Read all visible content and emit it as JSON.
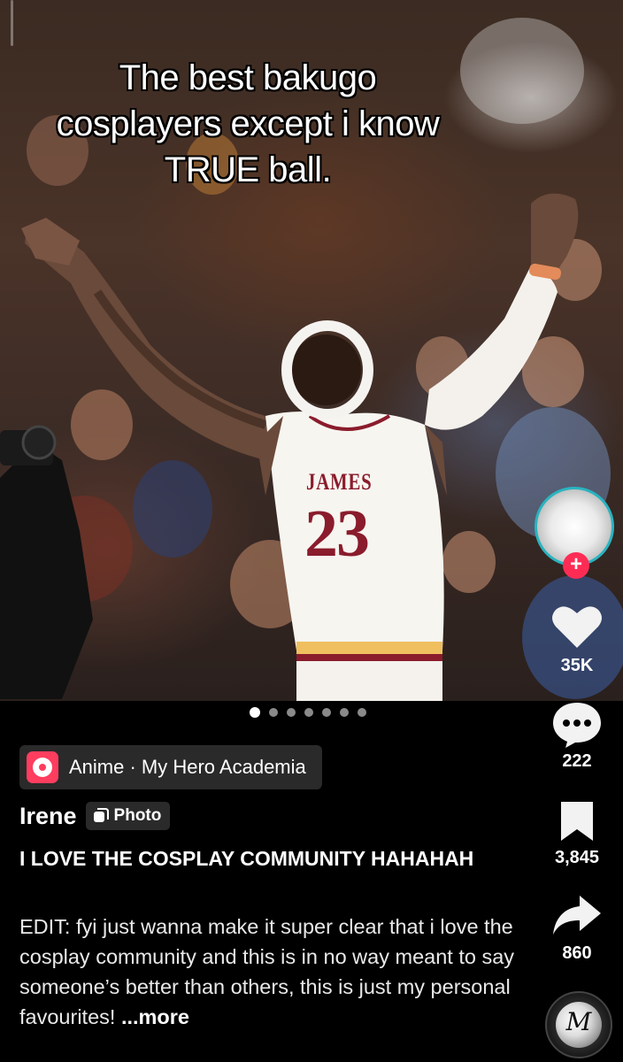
{
  "post": {
    "caption_overlay": "The best bakugo cosplayers except i know TRUE ball.",
    "jersey_name": "JAMES",
    "jersey_number": "23",
    "photo_count": 7,
    "active_photo_index": 0
  },
  "rail": {
    "likes": "35K",
    "comments": "222",
    "saves": "3,845",
    "shares": "860"
  },
  "anchor": {
    "label": "Anime · My Hero Academia"
  },
  "author": {
    "name": "Irene",
    "badge_label": "Photo"
  },
  "title": "I LOVE THE COSPLAY COMMUNITY HAHAHAH",
  "description": {
    "text": "EDIT: fyi just wanna make it super clear that i love the cosplay community and this is in no way meant to say someone’s better than others, this is just my personal favourites! ",
    "more_label": "...more"
  },
  "music": {
    "disc_text": "M"
  },
  "colors": {
    "follow_red": "#fe2c55",
    "avatar_ring": "#2ab3c0",
    "anchor_red": "#ff3d5f"
  }
}
